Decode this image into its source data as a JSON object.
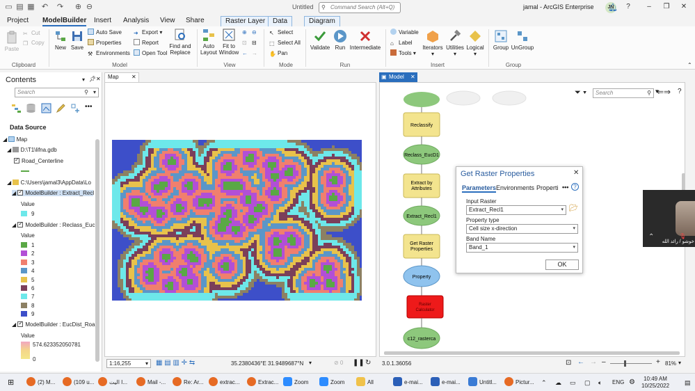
{
  "window": {
    "doc_title": "Untitled",
    "command_search_placeholder": "Command Search (Alt+Q)",
    "user": "jamal - ArcGIS Enterprise",
    "avatar_initials": "JN"
  },
  "tabs": [
    "Project",
    "ModelBuilder",
    "Insert",
    "Analysis",
    "View",
    "Share",
    "Raster Layer",
    "Data",
    "Diagram"
  ],
  "ribbon": {
    "clipboard": {
      "paste": "Paste",
      "cut": "Cut",
      "copy": "Copy",
      "group": "Clipboard"
    },
    "model": {
      "new": "New",
      "save": "Save",
      "auto_save": "Auto Save",
      "properties": "Properties",
      "environments": "Environments",
      "export": "Export",
      "report": "Report",
      "open_tool": "Open Tool",
      "find_replace_1": "Find and",
      "find_replace_2": "Replace",
      "group": "Model"
    },
    "view": {
      "auto_layout_1": "Auto",
      "auto_layout_2": "Layout",
      "fit_window_1": "Fit to",
      "fit_window_2": "Window",
      "group": "View"
    },
    "mode": {
      "select": "Select",
      "select_all": "Select All",
      "pan": "Pan",
      "group": "Mode"
    },
    "run": {
      "validate": "Validate",
      "run": "Run",
      "intermediate": "Intermediate",
      "group": "Run"
    },
    "insert": {
      "variable": "Variable",
      "label": "Label",
      "tools": "Tools",
      "iterators": "Iterators",
      "utilities": "Utilities",
      "logical": "Logical",
      "group": "Insert"
    },
    "group": {
      "group": "Group",
      "ungroup": "UnGroup",
      "group_label": "Group"
    }
  },
  "contents": {
    "title": "Contents",
    "search_placeholder": "Search",
    "data_source": "Data Source",
    "map": "Map",
    "gdb": "D:\\T1\\lifna.gdb",
    "road": "Road_Centerline",
    "appdata": "C:\\Users\\jamal3\\AppData\\Lo",
    "layer1": "ModelBuilder : Extract_Recl",
    "value_label": "Value",
    "layer1_value": "9",
    "layer2": "ModelBuilder : Reclass_Euc",
    "layer2_values": [
      "1",
      "2",
      "3",
      "4",
      "5",
      "6",
      "7",
      "8",
      "9"
    ],
    "layer3": "ModelBuilder : EucDist_Roa",
    "layer3_max": "574.623352050781",
    "layer3_min": "0"
  },
  "colors": {
    "c1": "#5aa845",
    "c2": "#b24fd6",
    "c3": "#f07f6e",
    "c4": "#5b96c8",
    "c5": "#e8c24b",
    "c6": "#7b3f5a",
    "c7": "#6de8ea",
    "c8": "#8c8063",
    "c9": "#3d4fc9"
  },
  "map": {
    "tab": "Map",
    "scale": "1:16,255",
    "coords": "35.2380436°E 31.9489687°N"
  },
  "model": {
    "tab": "Model",
    "search_placeholder": "Search",
    "version": "3.0.1.36056",
    "zoom": "81%",
    "nodes": {
      "reclassify": "Reclassify",
      "reclass_eucd1": "Reclass_EucD1",
      "extract_1": "Extract by",
      "extract_2": "Attributes",
      "extract_recl1": "Extract_Recl1",
      "getraster_1": "Get Raster",
      "getraster_2": "Properties",
      "property": "Property",
      "rastercalc_1": "Raster",
      "rastercalc_2": "Calculator",
      "output": "c12_rasterca"
    }
  },
  "dialog": {
    "title": "Get Raster Properties",
    "tab_parameters": "Parameters",
    "tab_environments": "Environments",
    "tab_properties": "Properti",
    "input_raster_label": "Input Raster",
    "input_raster_value": "Extract_Recl1",
    "property_type_label": "Property type",
    "property_type_value": "Cell size x-direction",
    "band_name_label": "Band Name",
    "band_name_value": "Band_1",
    "ok": "OK"
  },
  "video": {
    "name": "خوشو / رائد الله"
  },
  "taskbar": {
    "items": [
      "(2) M...",
      "(109 u...",
      "اليت I...",
      "Mail -...",
      "Re: Ar...",
      "extrac...",
      "Extrac...",
      "Zoom",
      "Zoom",
      "All",
      "e-mai...",
      "e-mai...",
      "Untitl...",
      "Pictur..."
    ],
    "lang": "ENG",
    "time": "10:49 AM",
    "date": "10/25/2022"
  }
}
